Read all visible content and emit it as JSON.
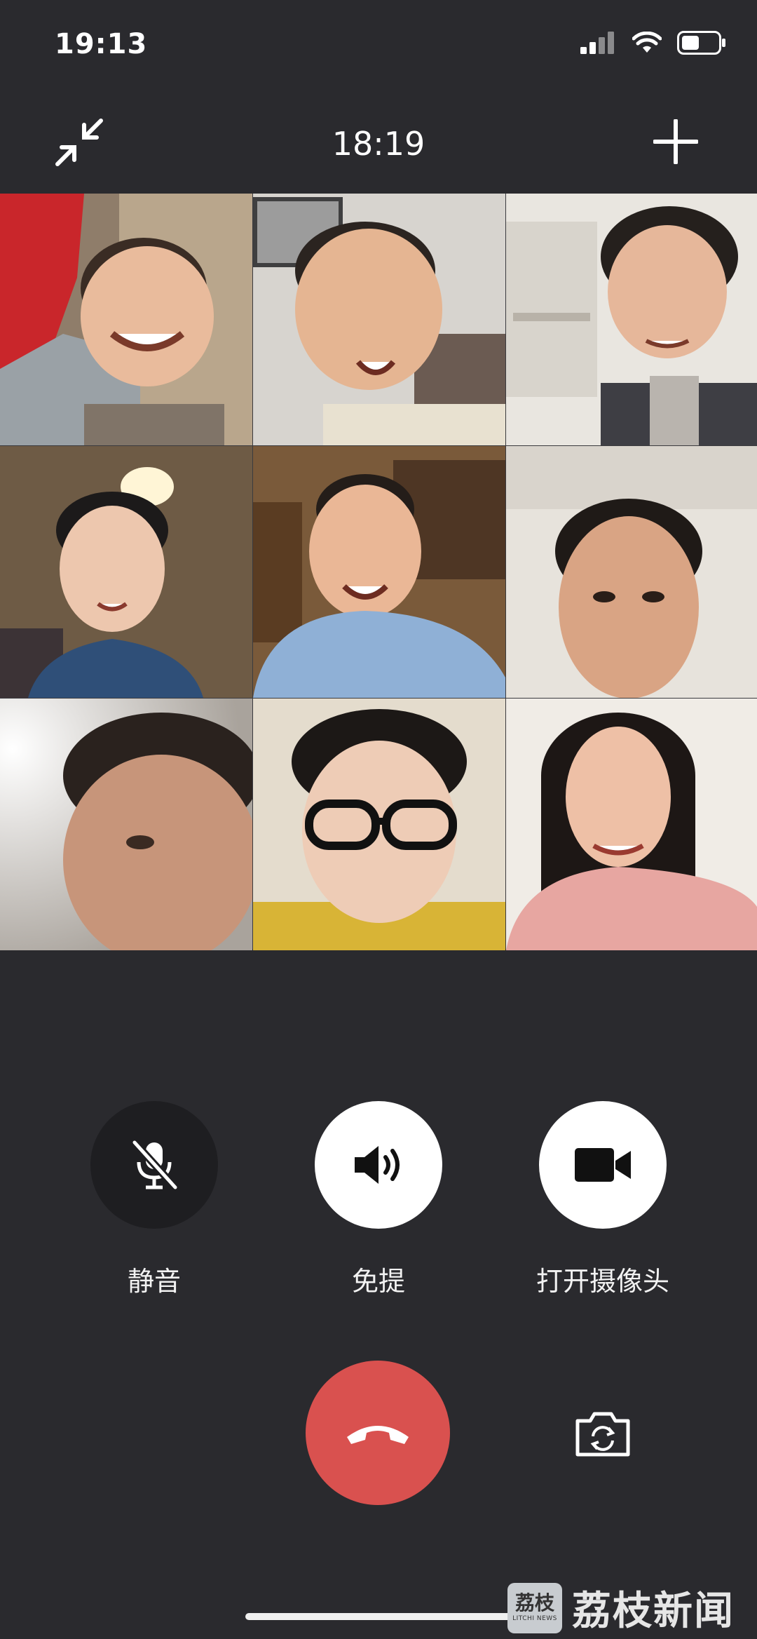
{
  "status_bar": {
    "time": "19:13"
  },
  "top_bar": {
    "call_duration": "18:19"
  },
  "participants": [
    {
      "id": "p1"
    },
    {
      "id": "p2"
    },
    {
      "id": "p3"
    },
    {
      "id": "p4"
    },
    {
      "id": "p5"
    },
    {
      "id": "p6"
    },
    {
      "id": "p7"
    },
    {
      "id": "p8"
    },
    {
      "id": "p9"
    }
  ],
  "controls": {
    "mute_label": "静音",
    "speaker_label": "免提",
    "camera_label": "打开摄像头"
  },
  "watermark": {
    "badge_cn": "荔枝",
    "badge_en": "LITCHI NEWS",
    "text": "荔枝新闻"
  },
  "colors": {
    "background": "#2a2a2e",
    "end_call": "#d9514f",
    "mute_circle": "#1e1e21",
    "control_circle": "#ffffff"
  }
}
